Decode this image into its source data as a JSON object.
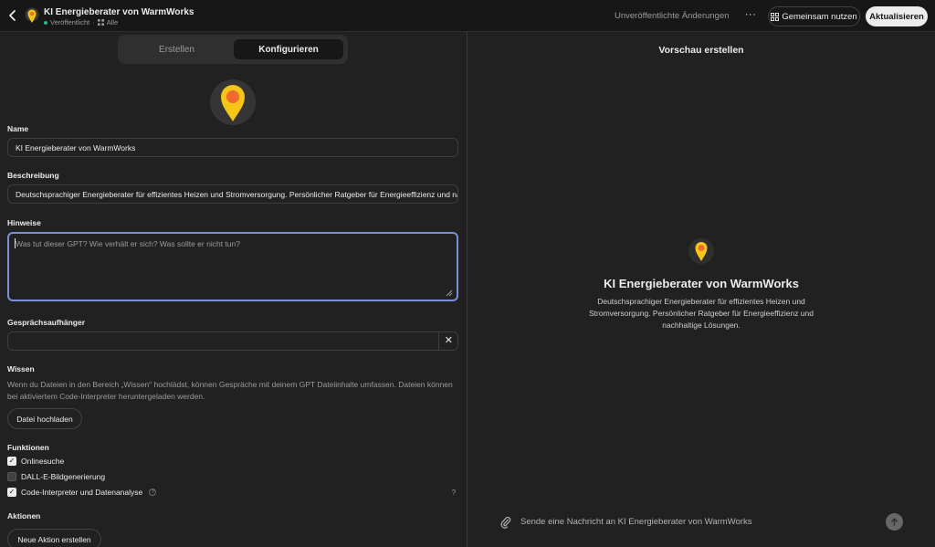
{
  "header": {
    "title": "KI Energieberater von WarmWorks",
    "status": "Veröffentlicht",
    "separator": "·",
    "audience": "Alle",
    "unpublished_changes": "Unveröffentlichte Änderungen",
    "more_label": "···",
    "share_label": "Gemeinsam nutzen",
    "update_label": "Aktualisieren"
  },
  "tabs": [
    {
      "label": "Erstellen",
      "active": false
    },
    {
      "label": "Konfigurieren",
      "active": true
    }
  ],
  "form": {
    "name_label": "Name",
    "name_value": "KI Energieberater von WarmWorks",
    "description_label": "Beschreibung",
    "description_value": "Deutschsprachiger Energieberater für effizientes Heizen und Stromversorgung. Persönlicher Ratgeber für Energieeffizienz und nachhaltige Lösungen.",
    "instructions_label": "Hinweise",
    "instructions_placeholder": "Was tut dieser GPT? Wie verhält er sich? Was sollte er nicht tun?",
    "starters_label": "Gesprächsaufhänger",
    "starter_value": "",
    "knowledge_label": "Wissen",
    "knowledge_help": "Wenn du Dateien in den Bereich „Wissen“ hochlädst, können Gespräche mit deinem GPT Dateiinhalte umfassen. Dateien können bei aktiviertem Code-Interpreter heruntergeladen werden.",
    "upload_label": "Datei hochladen",
    "capabilities_label": "Funktionen",
    "capabilities": [
      {
        "label": "Onlinesuche",
        "checked": true
      },
      {
        "label": "DALL-E-Bildgenerierung",
        "checked": false
      },
      {
        "label": "Code-Interpreter und Datenanalyse",
        "checked": true
      }
    ],
    "info_glyph": "?",
    "actions_label": "Aktionen",
    "new_action_label": "Neue Aktion erstellen"
  },
  "preview": {
    "title": "Vorschau erstellen",
    "name": "KI Energieberater von WarmWorks",
    "description": "Deutschsprachiger Energieberater für effizientes Heizen und Stromversorgung. Persönlicher Ratgeber für Energieeffizienz und nachhaltige Lösungen.",
    "composer_placeholder": "Sende eine Nachricht an KI Energieberater von WarmWorks",
    "help_label": "?"
  },
  "colors": {
    "pin_yellow": "#f5c518",
    "pin_orange": "#f06a2e",
    "focus_border": "#7b8fd8"
  }
}
